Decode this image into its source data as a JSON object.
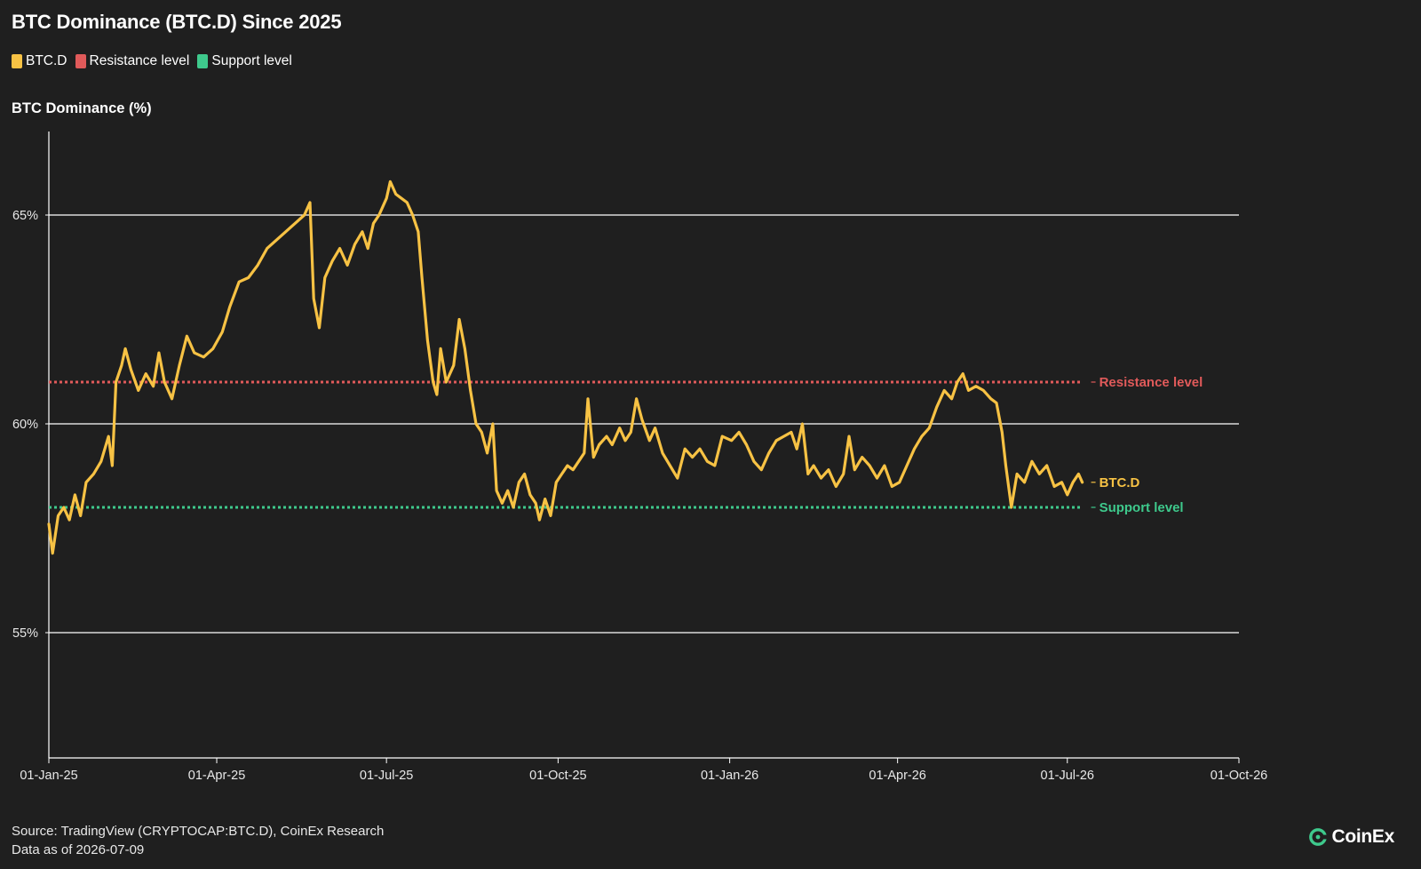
{
  "header": {
    "title": "BTC Dominance (BTC.D) Since 2025"
  },
  "legend": [
    {
      "label": "BTC.D",
      "color": "#f7c244"
    },
    {
      "label": "Resistance level",
      "color": "#e05a5a"
    },
    {
      "label": "Support level",
      "color": "#3ec98c"
    }
  ],
  "footer": {
    "source": "Source: TradingView (CRYPTOCAP:BTC.D), CoinEx Research",
    "asof": "Data as of 2026-07-09"
  },
  "brand": {
    "name": "CoinEx",
    "icon": "coinex-logo-icon"
  },
  "chart_data": {
    "type": "line",
    "ylabel": "BTC Dominance (%)",
    "ylim": [
      52,
      67
    ],
    "yticks": [
      55,
      60,
      65
    ],
    "ytick_labels": [
      "55%",
      "60%",
      "65%"
    ],
    "xlim": [
      "2025-01-01",
      "2026-10-01"
    ],
    "xticks": [
      "2025-01-01",
      "2025-04-01",
      "2025-07-01",
      "2025-10-01",
      "2026-01-01",
      "2026-04-01",
      "2026-07-01",
      "2026-10-01"
    ],
    "xtick_labels": [
      "01-Jan-25",
      "01-Apr-25",
      "01-Jul-25",
      "01-Oct-25",
      "01-Jan-26",
      "01-Apr-26",
      "01-Jul-26",
      "01-Oct-26"
    ],
    "grid": true,
    "legend_position": "top-left",
    "series": [
      {
        "name": "BTC.D",
        "color": "#f7c244",
        "end_label": "BTC.D",
        "points": [
          [
            "2025-01-01",
            57.6
          ],
          [
            "2025-01-03",
            56.9
          ],
          [
            "2025-01-06",
            57.8
          ],
          [
            "2025-01-09",
            58.0
          ],
          [
            "2025-01-12",
            57.7
          ],
          [
            "2025-01-15",
            58.3
          ],
          [
            "2025-01-18",
            57.8
          ],
          [
            "2025-01-21",
            58.6
          ],
          [
            "2025-01-25",
            58.8
          ],
          [
            "2025-01-29",
            59.1
          ],
          [
            "2025-02-02",
            59.7
          ],
          [
            "2025-02-04",
            59.0
          ],
          [
            "2025-02-06",
            61.0
          ],
          [
            "2025-02-09",
            61.4
          ],
          [
            "2025-02-11",
            61.8
          ],
          [
            "2025-02-14",
            61.3
          ],
          [
            "2025-02-18",
            60.8
          ],
          [
            "2025-02-22",
            61.2
          ],
          [
            "2025-02-26",
            60.9
          ],
          [
            "2025-03-01",
            61.7
          ],
          [
            "2025-03-04",
            61.0
          ],
          [
            "2025-03-08",
            60.6
          ],
          [
            "2025-03-12",
            61.4
          ],
          [
            "2025-03-16",
            62.1
          ],
          [
            "2025-03-20",
            61.7
          ],
          [
            "2025-03-25",
            61.6
          ],
          [
            "2025-03-30",
            61.8
          ],
          [
            "2025-04-04",
            62.2
          ],
          [
            "2025-04-08",
            62.8
          ],
          [
            "2025-04-13",
            63.4
          ],
          [
            "2025-04-18",
            63.5
          ],
          [
            "2025-04-23",
            63.8
          ],
          [
            "2025-04-28",
            64.2
          ],
          [
            "2025-05-03",
            64.4
          ],
          [
            "2025-05-08",
            64.6
          ],
          [
            "2025-05-13",
            64.8
          ],
          [
            "2025-05-18",
            65.0
          ],
          [
            "2025-05-21",
            65.3
          ],
          [
            "2025-05-23",
            63.0
          ],
          [
            "2025-05-26",
            62.3
          ],
          [
            "2025-05-29",
            63.5
          ],
          [
            "2025-06-02",
            63.9
          ],
          [
            "2025-06-06",
            64.2
          ],
          [
            "2025-06-10",
            63.8
          ],
          [
            "2025-06-14",
            64.3
          ],
          [
            "2025-06-18",
            64.6
          ],
          [
            "2025-06-21",
            64.2
          ],
          [
            "2025-06-24",
            64.8
          ],
          [
            "2025-06-27",
            65.0
          ],
          [
            "2025-07-01",
            65.4
          ],
          [
            "2025-07-03",
            65.8
          ],
          [
            "2025-07-06",
            65.5
          ],
          [
            "2025-07-09",
            65.4
          ],
          [
            "2025-07-12",
            65.3
          ],
          [
            "2025-07-15",
            65.0
          ],
          [
            "2025-07-18",
            64.6
          ],
          [
            "2025-07-20",
            63.5
          ],
          [
            "2025-07-23",
            62.0
          ],
          [
            "2025-07-26",
            61.0
          ],
          [
            "2025-07-28",
            60.7
          ],
          [
            "2025-07-30",
            61.8
          ],
          [
            "2025-08-02",
            61.0
          ],
          [
            "2025-08-06",
            61.4
          ],
          [
            "2025-08-09",
            62.5
          ],
          [
            "2025-08-12",
            61.8
          ],
          [
            "2025-08-15",
            60.8
          ],
          [
            "2025-08-18",
            60.0
          ],
          [
            "2025-08-21",
            59.8
          ],
          [
            "2025-08-24",
            59.3
          ],
          [
            "2025-08-27",
            60.0
          ],
          [
            "2025-08-29",
            58.4
          ],
          [
            "2025-09-01",
            58.1
          ],
          [
            "2025-09-04",
            58.4
          ],
          [
            "2025-09-07",
            58.0
          ],
          [
            "2025-09-10",
            58.6
          ],
          [
            "2025-09-13",
            58.8
          ],
          [
            "2025-09-16",
            58.3
          ],
          [
            "2025-09-19",
            58.1
          ],
          [
            "2025-09-21",
            57.7
          ],
          [
            "2025-09-24",
            58.2
          ],
          [
            "2025-09-27",
            57.8
          ],
          [
            "2025-09-30",
            58.6
          ],
          [
            "2025-10-03",
            58.8
          ],
          [
            "2025-10-06",
            59.0
          ],
          [
            "2025-10-09",
            58.9
          ],
          [
            "2025-10-12",
            59.1
          ],
          [
            "2025-10-15",
            59.3
          ],
          [
            "2025-10-17",
            60.6
          ],
          [
            "2025-10-20",
            59.2
          ],
          [
            "2025-10-23",
            59.5
          ],
          [
            "2025-10-27",
            59.7
          ],
          [
            "2025-10-30",
            59.5
          ],
          [
            "2025-11-03",
            59.9
          ],
          [
            "2025-11-06",
            59.6
          ],
          [
            "2025-11-09",
            59.8
          ],
          [
            "2025-11-12",
            60.6
          ],
          [
            "2025-11-15",
            60.1
          ],
          [
            "2025-11-19",
            59.6
          ],
          [
            "2025-11-22",
            59.9
          ],
          [
            "2025-11-26",
            59.3
          ],
          [
            "2025-11-30",
            59.0
          ],
          [
            "2025-12-04",
            58.7
          ],
          [
            "2025-12-08",
            59.4
          ],
          [
            "2025-12-12",
            59.2
          ],
          [
            "2025-12-16",
            59.4
          ],
          [
            "2025-12-20",
            59.1
          ],
          [
            "2025-12-24",
            59.0
          ],
          [
            "2025-12-28",
            59.7
          ],
          [
            "2026-01-02",
            59.6
          ],
          [
            "2026-01-06",
            59.8
          ],
          [
            "2026-01-10",
            59.5
          ],
          [
            "2026-01-14",
            59.1
          ],
          [
            "2026-01-18",
            58.9
          ],
          [
            "2026-01-22",
            59.3
          ],
          [
            "2026-01-26",
            59.6
          ],
          [
            "2026-01-30",
            59.7
          ],
          [
            "2026-02-03",
            59.8
          ],
          [
            "2026-02-06",
            59.4
          ],
          [
            "2026-02-09",
            60.0
          ],
          [
            "2026-02-12",
            58.8
          ],
          [
            "2026-02-15",
            59.0
          ],
          [
            "2026-02-19",
            58.7
          ],
          [
            "2026-02-23",
            58.9
          ],
          [
            "2026-02-27",
            58.5
          ],
          [
            "2026-03-03",
            58.8
          ],
          [
            "2026-03-06",
            59.7
          ],
          [
            "2026-03-09",
            58.9
          ],
          [
            "2026-03-13",
            59.2
          ],
          [
            "2026-03-17",
            59.0
          ],
          [
            "2026-03-21",
            58.7
          ],
          [
            "2026-03-25",
            59.0
          ],
          [
            "2026-03-29",
            58.5
          ],
          [
            "2026-04-02",
            58.6
          ],
          [
            "2026-04-06",
            59.0
          ],
          [
            "2026-04-10",
            59.4
          ],
          [
            "2026-04-14",
            59.7
          ],
          [
            "2026-04-18",
            59.9
          ],
          [
            "2026-04-22",
            60.4
          ],
          [
            "2026-04-26",
            60.8
          ],
          [
            "2026-04-30",
            60.6
          ],
          [
            "2026-05-03",
            61.0
          ],
          [
            "2026-05-06",
            61.2
          ],
          [
            "2026-05-09",
            60.8
          ],
          [
            "2026-05-13",
            60.9
          ],
          [
            "2026-05-17",
            60.8
          ],
          [
            "2026-05-21",
            60.6
          ],
          [
            "2026-05-24",
            60.5
          ],
          [
            "2026-05-27",
            59.8
          ],
          [
            "2026-05-29",
            59.0
          ],
          [
            "2026-06-01",
            58.0
          ],
          [
            "2026-06-04",
            58.8
          ],
          [
            "2026-06-08",
            58.6
          ],
          [
            "2026-06-12",
            59.1
          ],
          [
            "2026-06-16",
            58.8
          ],
          [
            "2026-06-20",
            59.0
          ],
          [
            "2026-06-24",
            58.5
          ],
          [
            "2026-06-28",
            58.6
          ],
          [
            "2026-07-01",
            58.3
          ],
          [
            "2026-07-04",
            58.6
          ],
          [
            "2026-07-07",
            58.8
          ],
          [
            "2026-07-09",
            58.6
          ]
        ]
      },
      {
        "name": "Resistance level",
        "color": "#e05a5a",
        "style": "dotted",
        "value": 61.0,
        "x_range": [
          "2025-01-01",
          "2026-07-09"
        ],
        "end_label": "Resistance level"
      },
      {
        "name": "Support level",
        "color": "#3ec98c",
        "style": "dotted",
        "value": 58.0,
        "x_range": [
          "2025-01-01",
          "2026-07-09"
        ],
        "end_label": "Support level"
      }
    ]
  }
}
